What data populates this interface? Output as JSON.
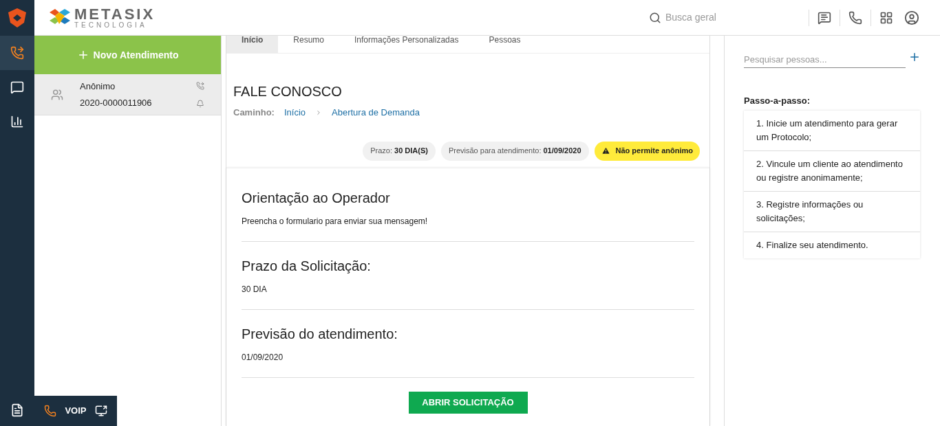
{
  "rail": {
    "items": [
      {
        "kind": "phone",
        "selected": true
      },
      {
        "kind": "chat",
        "selected": false
      },
      {
        "kind": "chart",
        "selected": false
      }
    ]
  },
  "header": {
    "brand": "METASIX",
    "brand_sub": "TECNOLOGIA",
    "search": {
      "placeholder": "Busca geral"
    }
  },
  "queue": {
    "new_button": "Novo Atendimento",
    "items": [
      {
        "name": "Anônimo",
        "protocol": "2020-0000011906",
        "selected": true
      }
    ]
  },
  "tabs": [
    {
      "label": "Início",
      "selected": true
    },
    {
      "label": "Resumo",
      "selected": false
    },
    {
      "label": "Informações Personalizadas",
      "selected": false
    },
    {
      "label": "Pessoas",
      "selected": false
    }
  ],
  "page": {
    "title": "FALE CONOSCO",
    "path_label": "Caminho:",
    "path": [
      "Início",
      "Abertura de Demanda"
    ],
    "chips": [
      {
        "kind": "info",
        "label": "Prazo:",
        "value": "30 DIA(S)"
      },
      {
        "kind": "info",
        "label": "Previsão para atendimento:",
        "value": "01/09/2020"
      },
      {
        "kind": "warning",
        "label": "Não permite anônimo"
      }
    ],
    "sections": [
      {
        "title": "Orientação ao Operador",
        "text": "Preencha o formulario para enviar sua mensagem!"
      },
      {
        "title": "Prazo da Solicitação:",
        "text": "30 DIA"
      },
      {
        "title": "Previsão do atendimento:",
        "text": "01/09/2020"
      }
    ],
    "submit": "ABRIR SOLICITAÇÃO"
  },
  "people": {
    "search": {
      "placeholder": "Pesquisar pessoas..."
    },
    "steps_title": "Passo-a-passo:",
    "steps": [
      "1. Inicie um atendimento para gerar um Protocolo;",
      "2. Vincule um cliente ao atendimento ou registre anonimamente;",
      "3. Registre informações ou solicitações;",
      "4. Finalize seu atendimento."
    ]
  },
  "voip": {
    "label": "VOIP"
  }
}
